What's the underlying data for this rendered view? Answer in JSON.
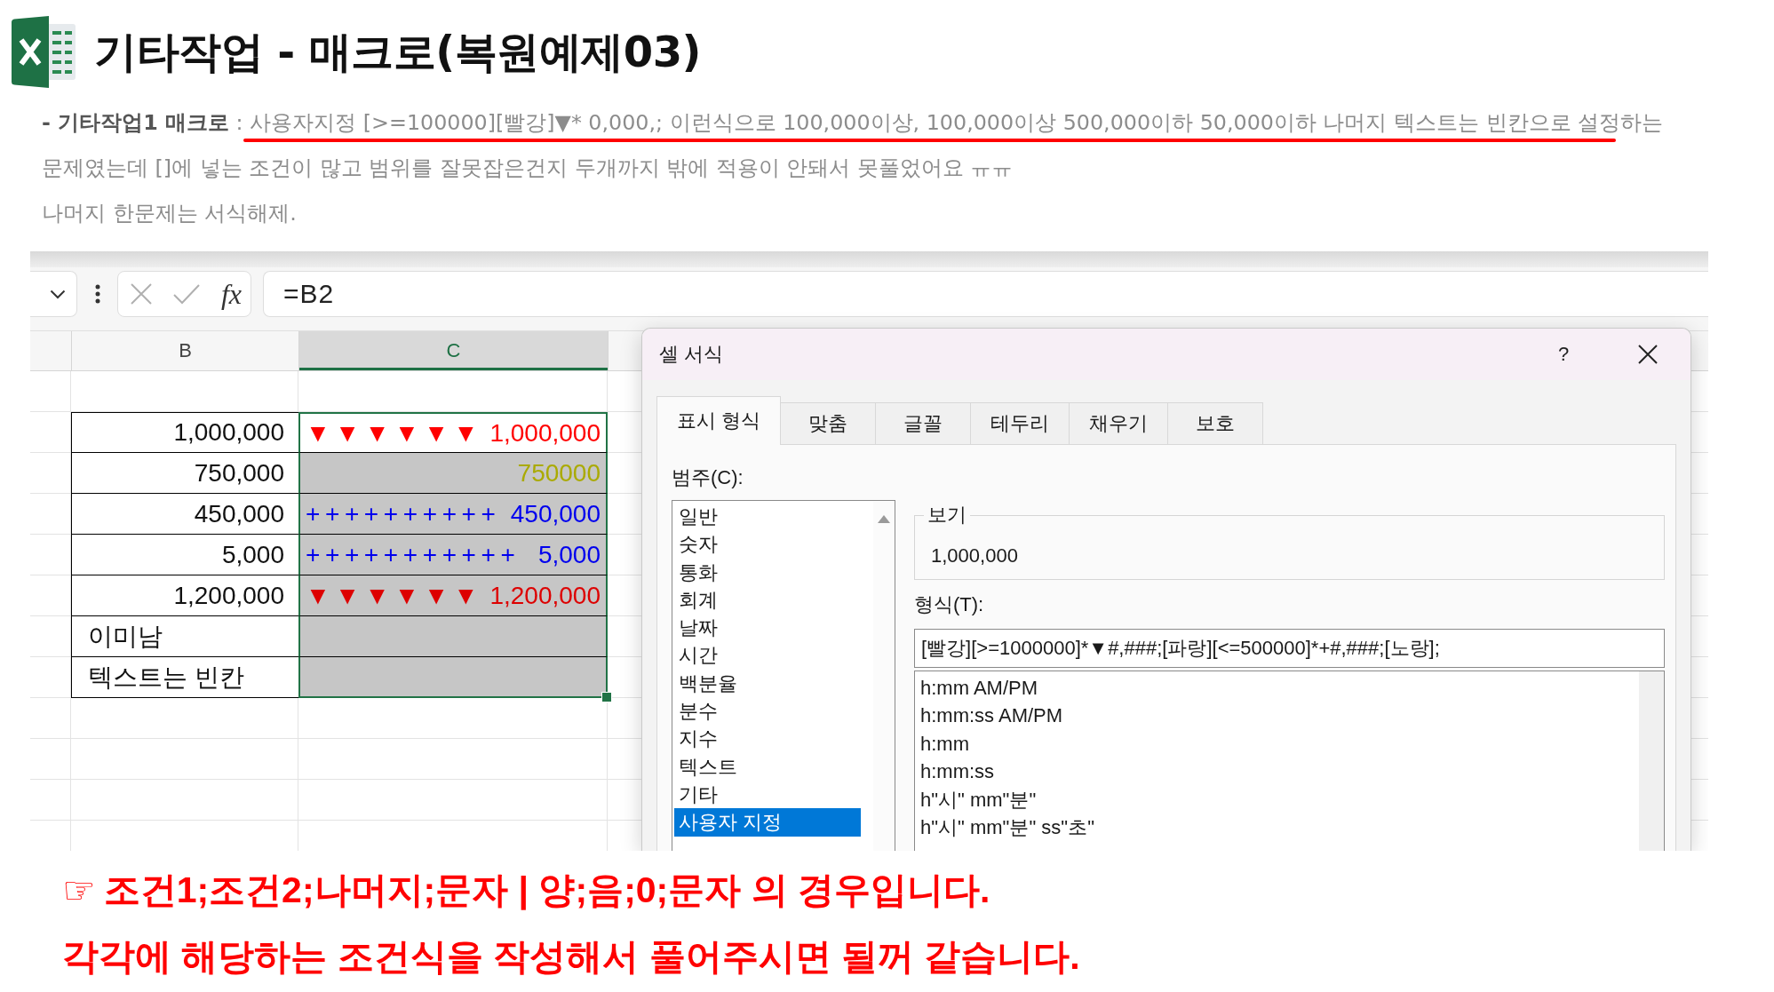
{
  "header": {
    "title": "기타작업 - 매크로(복원예제03)"
  },
  "post": {
    "lines": [
      {
        "text": "**- 기타작업1 매크로** : 사용자지정 [>=100000][빨강]▼* 0,000,; 이런식으로 100,000이상, 100,000이상 500,000이하 50,000이하 나머지 텍스트는 빈칸으로 설정하는",
        "underlined": true
      },
      {
        "text": "문제였는데 []에 넣는 조건이 많고 범위를 잘못잡은건지 두개까지 밖에 적용이 안돼서 못풀었어요 ㅠㅠ",
        "underlined": false
      },
      {
        "text": "나머지 한문제는 서식해제.",
        "underlined": false
      }
    ]
  },
  "spreadsheet": {
    "formula_bar": {
      "function_label": "fx",
      "formula": "=B2"
    },
    "columns": [
      {
        "label": "B",
        "selected": false
      },
      {
        "label": "C",
        "selected": true
      }
    ],
    "rows": [
      {
        "kind": "number",
        "b": "1,000,000",
        "c_fill": "▼▼▼▼▼▼",
        "c_value": "1,000,000",
        "color": "#ff0000",
        "selected": true,
        "active": true
      },
      {
        "kind": "number",
        "b": "750,000",
        "c_value": "750000",
        "color": "#aaaa00",
        "selected": true,
        "active": false
      },
      {
        "kind": "number",
        "b": "450,000",
        "c_fill": "++++++++++",
        "c_value": "450,000",
        "color": "#0000ee",
        "selected": true,
        "active": false
      },
      {
        "kind": "number",
        "b": "5,000",
        "c_fill": "+++++++++++",
        "c_value": "5,000",
        "color": "#0000ee",
        "selected": true,
        "active": false
      },
      {
        "kind": "number",
        "b": "1,200,000",
        "c_fill": "▼▼▼▼▼▼",
        "c_value": "1,200,000",
        "color": "#dd0000",
        "selected": true,
        "active": false
      },
      {
        "kind": "text",
        "b": "이미남",
        "selected": true,
        "active": false
      },
      {
        "kind": "text",
        "b": "텍스트는 빈칸",
        "selected": true,
        "active": false
      }
    ]
  },
  "dialog": {
    "title": "셀 서식",
    "help": "?",
    "tabs": [
      {
        "label": "표시 형식",
        "selected": true
      },
      {
        "label": "맞춤",
        "selected": false
      },
      {
        "label": "글꼴",
        "selected": false
      },
      {
        "label": "테두리",
        "selected": false
      },
      {
        "label": "채우기",
        "selected": false
      },
      {
        "label": "보호",
        "selected": false
      }
    ],
    "category_label": "범주(C):",
    "categories": [
      {
        "label": "일반",
        "selected": false
      },
      {
        "label": "숫자",
        "selected": false
      },
      {
        "label": "통화",
        "selected": false
      },
      {
        "label": "회계",
        "selected": false
      },
      {
        "label": "날짜",
        "selected": false
      },
      {
        "label": "시간",
        "selected": false
      },
      {
        "label": "백분율",
        "selected": false
      },
      {
        "label": "분수",
        "selected": false
      },
      {
        "label": "지수",
        "selected": false
      },
      {
        "label": "텍스트",
        "selected": false
      },
      {
        "label": "기타",
        "selected": false
      },
      {
        "label": "사용자 지정",
        "selected": true
      }
    ],
    "preview_label": "보기",
    "preview_value": "1,000,000",
    "format_label": "형식(T):",
    "format_value": "[빨강][>=1000000]*▼#,###;[파랑][<=500000]*+#,###;[노랑];",
    "format_options": [
      {
        "label": "h:mm AM/PM",
        "selected": false
      },
      {
        "label": "h:mm:ss AM/PM",
        "selected": false
      },
      {
        "label": "h:mm",
        "selected": false
      },
      {
        "label": "h:mm:ss",
        "selected": false
      },
      {
        "label": "h\"시\" mm\"분\"",
        "selected": false
      },
      {
        "label": "h\"시\" mm\"분\" ss\"초\"",
        "selected": false
      }
    ]
  },
  "notes": [
    {
      "marker": "☞",
      "text": "조건1;조건2;나머지;문자 | 양;음;0;문자 의 경우입니다."
    },
    {
      "text": "각각에 해당하는 조건식을 작성해서 풀어주시면 될꺼 같습니다."
    }
  ]
}
